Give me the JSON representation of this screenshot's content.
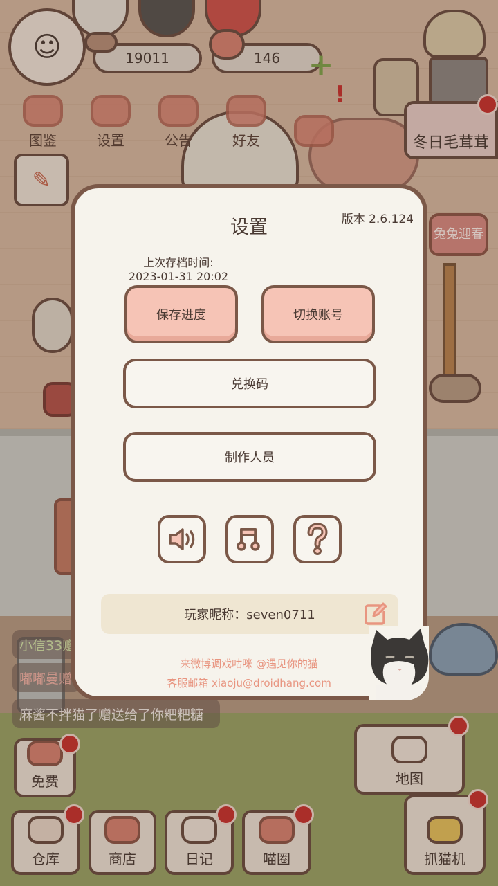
{
  "hud": {
    "coins": "19011",
    "hearts": "146"
  },
  "top_nav": [
    {
      "id": "encyclopedia",
      "label": "图鉴"
    },
    {
      "id": "settings",
      "label": "设置"
    },
    {
      "id": "notice",
      "label": "公告"
    },
    {
      "id": "friends",
      "label": "好友"
    }
  ],
  "event": {
    "banner": "冬日毛茸茸",
    "badge": "兔兔迎春"
  },
  "chat": [
    "小信33赠",
    "嘟嘟曼赠",
    "麻酱不拌猫了赠送给了你粑粑糖"
  ],
  "bottom_nav": {
    "free": "免费",
    "warehouse": "仓库",
    "shop": "商店",
    "diary": "日记",
    "circle": "喵圈",
    "map": "地图",
    "claw": "抓猫机"
  },
  "settings_dialog": {
    "title": "设置",
    "version": "版本 2.6.124",
    "last_save_label": "上次存档时间:",
    "last_save_time": "2023-01-31 20:02",
    "save_button": "保存进度",
    "switch_account_button": "切换账号",
    "redeem_button": "兑换码",
    "credits_button": "制作人员",
    "icon_buttons": [
      "sound-icon",
      "music-icon",
      "help-icon"
    ],
    "nickname": "玩家昵称：seven0711",
    "weibo": "来微博调戏咕咪 @遇见你的猫",
    "email": "客服邮箱 xiaoju@droidhang.com"
  },
  "colors": {
    "dialog_bg": "#f6f3ec",
    "dialog_border": "#7b5848",
    "pink_button": "#f6c4b6",
    "link_text": "#e89580",
    "notification": "#c9302c"
  }
}
